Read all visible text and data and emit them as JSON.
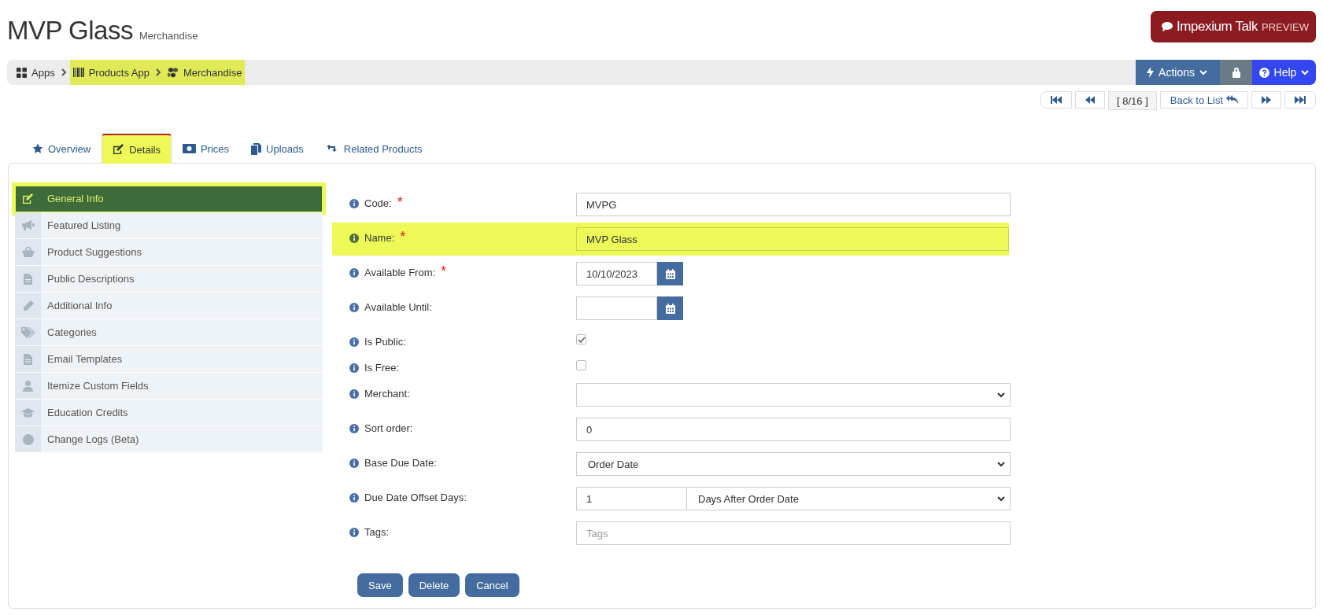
{
  "header": {
    "title": "MVP Glass",
    "subtitle": "Merchandise",
    "talk_button": {
      "label": "Impexium Talk",
      "badge": "PREVIEW"
    }
  },
  "breadcrumb": [
    {
      "label": "Apps",
      "highlighted": false
    },
    {
      "label": "Products App",
      "highlighted": true
    },
    {
      "label": "Merchandise",
      "highlighted": true
    }
  ],
  "toolbar": {
    "actions": "Actions",
    "help": "Help"
  },
  "record_nav": {
    "position": "[ 8/16 ]",
    "back": "Back to List"
  },
  "tabs": [
    {
      "label": "Overview",
      "selected": false,
      "highlighted": false
    },
    {
      "label": "Details",
      "selected": true,
      "highlighted": true
    },
    {
      "label": "Prices",
      "selected": false,
      "highlighted": false
    },
    {
      "label": "Uploads",
      "selected": false,
      "highlighted": false
    },
    {
      "label": "Related Products",
      "selected": false,
      "highlighted": false
    }
  ],
  "side_menu": [
    {
      "label": "General Info",
      "selected": true,
      "highlighted": true
    },
    {
      "label": "Featured Listing",
      "selected": false,
      "highlighted": false
    },
    {
      "label": "Product Suggestions",
      "selected": false,
      "highlighted": false
    },
    {
      "label": "Public Descriptions",
      "selected": false,
      "highlighted": false
    },
    {
      "label": "Additional Info",
      "selected": false,
      "highlighted": false
    },
    {
      "label": "Categories",
      "selected": false,
      "highlighted": false
    },
    {
      "label": "Email Templates",
      "selected": false,
      "highlighted": false
    },
    {
      "label": "Itemize Custom Fields",
      "selected": false,
      "highlighted": false
    },
    {
      "label": "Education Credits",
      "selected": false,
      "highlighted": false
    },
    {
      "label": "Change Logs (Beta)",
      "selected": false,
      "highlighted": false
    }
  ],
  "form": [
    {
      "kind": "text",
      "label": "Code:",
      "required_mark": "*",
      "value": "MVPG",
      "highlighted": false
    },
    {
      "kind": "text",
      "label": "Name:",
      "required_mark": "*",
      "value": "MVP Glass",
      "highlighted": true
    },
    {
      "kind": "date",
      "label": "Available From:",
      "required_mark": "*",
      "value": "10/10/2023",
      "highlighted": false
    },
    {
      "kind": "date",
      "label": "Available Until:",
      "highlighted": false
    },
    {
      "kind": "checkbox",
      "label": "Is Public:",
      "checked": true,
      "highlighted": false
    },
    {
      "kind": "checkbox",
      "label": "Is Free:",
      "checked": false,
      "highlighted": false
    },
    {
      "kind": "select",
      "label": "Merchant:",
      "highlighted": false
    },
    {
      "kind": "text",
      "label": "Sort order:",
      "value": "0",
      "highlighted": false
    },
    {
      "kind": "select",
      "label": "Base Due Date:",
      "value": "Order Date",
      "highlighted": false
    },
    {
      "kind": "pair",
      "label": "Due Date Offset Days:",
      "value": "1",
      "select_value": "Days After Order Date",
      "highlighted": false
    },
    {
      "kind": "text",
      "label": "Tags:",
      "placeholder": "Tags",
      "highlighted": false
    }
  ],
  "buttons": [
    "Save",
    "Delete",
    "Cancel"
  ]
}
